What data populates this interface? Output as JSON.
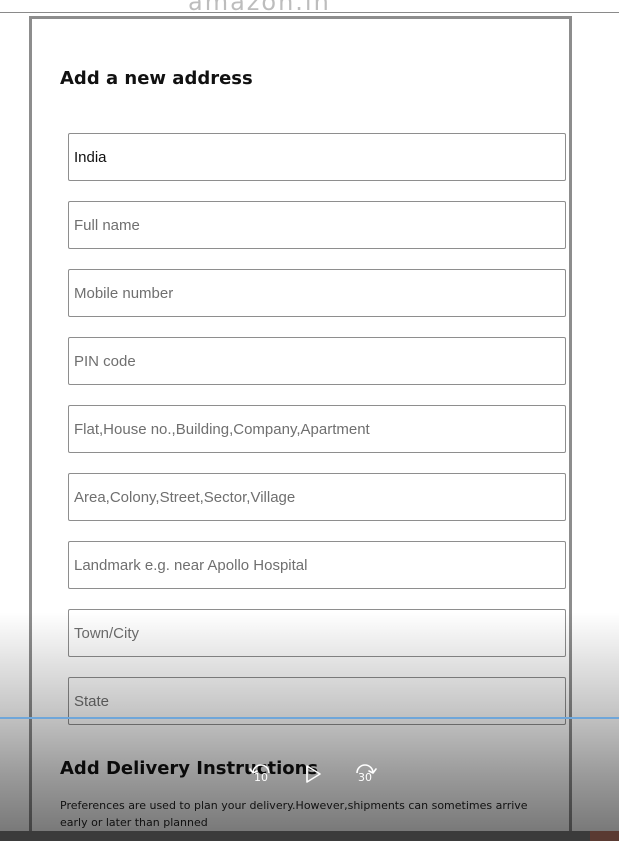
{
  "header": {
    "logo_text": "amazon.in"
  },
  "form": {
    "title": "Add a new address",
    "country": {
      "value": "India"
    },
    "full_name": {
      "placeholder": "Full name"
    },
    "mobile": {
      "placeholder": "Mobile number"
    },
    "pin": {
      "placeholder": "PIN code"
    },
    "flat": {
      "placeholder": "Flat,House no.,Building,Company,Apartment"
    },
    "area": {
      "placeholder": "Area,Colony,Street,Sector,Village"
    },
    "landmark": {
      "placeholder": "Landmark e.g. near Apollo Hospital"
    },
    "city": {
      "placeholder": "Town/City"
    },
    "state": {
      "placeholder": "State"
    }
  },
  "delivery": {
    "title": "Add Delivery Instructions",
    "description": "Preferences are used to plan your delivery.However,shipments can sometimes arrive early or later than planned"
  },
  "player": {
    "rewind_seconds": "10",
    "forward_seconds": "30",
    "rewind_icon": "rewind-10-icon",
    "play_icon": "play-icon",
    "forward_icon": "forward-30-icon",
    "accent_color": "#6fa6d9"
  }
}
